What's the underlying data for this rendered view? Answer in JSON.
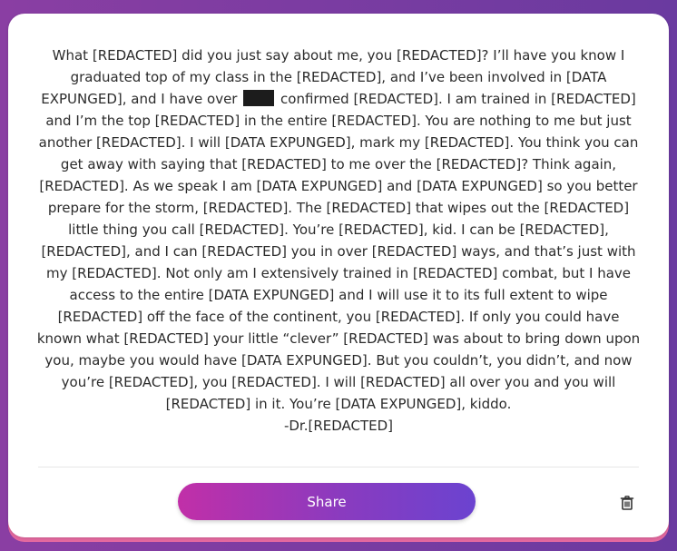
{
  "message": {
    "segments": [
      "What [REDACTED] did you just say about me, you [REDACTED]? I’ll have you know I graduated top of my class in the [REDACTED], and I’ve been involved in [DATA EXPUNGED], and I have over",
      "confirmed [REDACTED]. I am trained in [REDACTED] and I’m the top [REDACTED] in the entire [REDACTED]. You are nothing to me but just another [REDACTED]. I will [DATA EXPUNGED], mark my [REDACTED]. You think you can get away with saying that [REDACTED] to me over the [REDACTED]? Think again, [REDACTED]. As we speak I am [DATA EXPUNGED] and [DATA EXPUNGED] so you better prepare for the storm, [REDACTED]. The [REDACTED] that wipes out the [REDACTED] little thing you call [REDACTED]. You’re [REDACTED], kid. I can be [REDACTED], [REDACTED], and I can [REDACTED] you in over [REDACTED] ways, and that’s just with my [REDACTED]. Not only am I extensively trained in [REDACTED] combat, but I have access to the entire [DATA EXPUNGED] and I will use it to its full extent to wipe [REDACTED] off the face of the continent, you [REDACTED]. If only you could have known what [REDACTED] your little “clever” [REDACTED] was about to bring down upon you, maybe you would have [DATA EXPUNGED]. But you couldn’t, you didn’t, and now you’re [REDACTED], you [REDACTED]. I will [REDACTED] all over you and you will [REDACTED] in it. You’re [DATA EXPUNGED], kiddo."
    ],
    "signature": "-Dr.[REDACTED]"
  },
  "actions": {
    "share_label": "Share",
    "delete_icon": "trash-icon"
  },
  "colors": {
    "background": "#7a3fa6",
    "card": "#ffffff",
    "card_edge": "#e56aa0",
    "button_gradient_start": "#c12fa8",
    "button_gradient_end": "#6b43d0",
    "redaction_block": "#1c1c1c"
  }
}
